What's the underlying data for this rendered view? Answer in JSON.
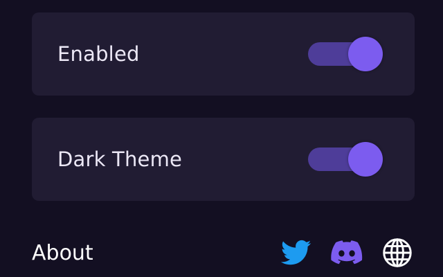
{
  "settings": {
    "enabled": {
      "label": "Enabled",
      "on": true
    },
    "dark_theme": {
      "label": "Dark Theme",
      "on": true
    }
  },
  "footer": {
    "about_label": "About",
    "icons": [
      "twitter-icon",
      "discord-icon",
      "globe-icon"
    ]
  },
  "colors": {
    "background": "#130f22",
    "card": "#211c33",
    "accent": "#7c5cef",
    "track": "#4e3d99",
    "twitter": "#1d9bf0",
    "discord": "#7c5cef"
  }
}
